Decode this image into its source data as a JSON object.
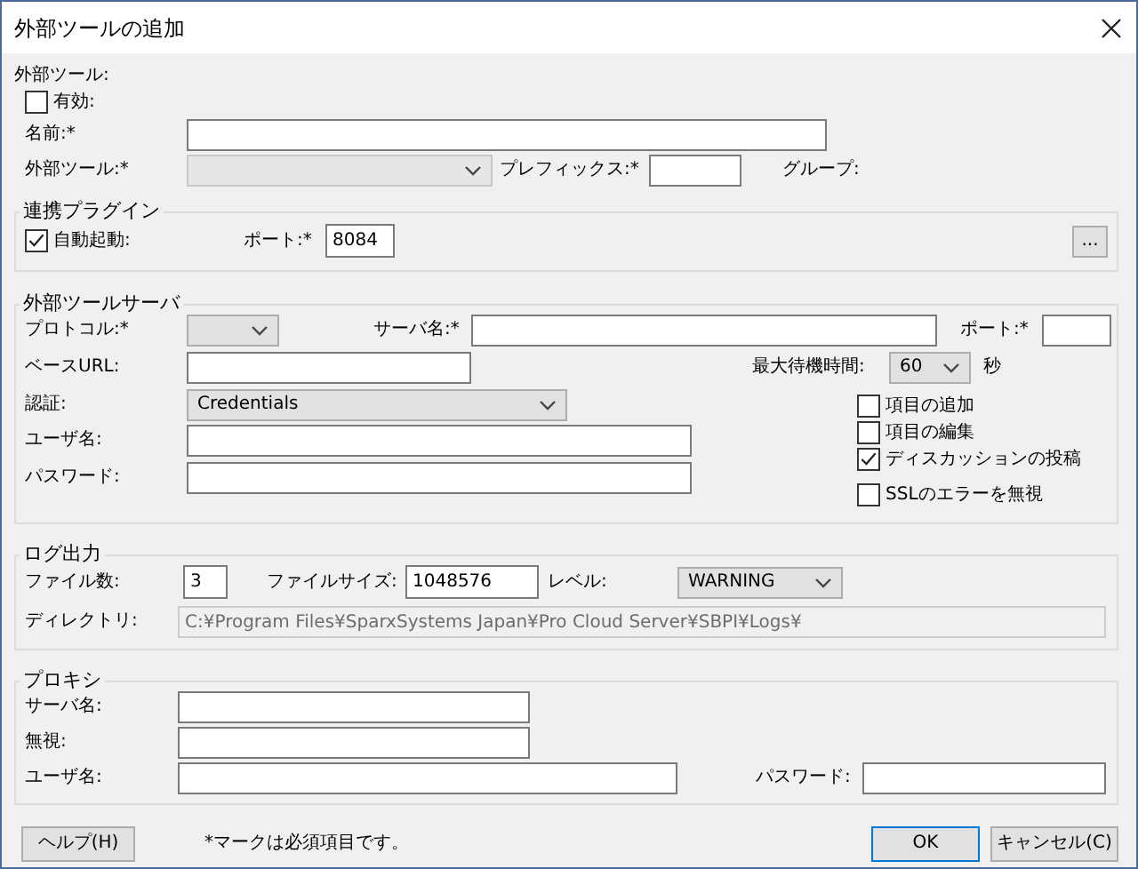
{
  "window": {
    "title": "外部ツールの追加"
  },
  "external_tool": {
    "heading": "外部ツール:",
    "enabled": {
      "label": "有効:",
      "checked": false
    },
    "name_label": "名前:*",
    "tool_label": "外部ツール:*",
    "tool_select": {
      "disabled": true
    },
    "prefix_label": "プレフィックス:*",
    "group_label": "グループ:"
  },
  "plugin": {
    "legend": "連携プラグイン",
    "auto_start": {
      "label": "自動起動:",
      "checked": true
    },
    "port_label": "ポート:*",
    "port_value": "8084",
    "more_button": "..."
  },
  "server": {
    "legend": "外部ツールサーバ",
    "protocol_label": "プロトコル:*",
    "server_name_label": "サーバ名:*",
    "port_label": "ポート:*",
    "base_url_label": "ベースURL:",
    "timeout_label": "最大待機時間:",
    "timeout_value": "60",
    "timeout_unit": "秒",
    "auth_label": "認証:",
    "auth_value": "Credentials",
    "username_label": "ユーザ名:",
    "password_label": "パスワード:",
    "options": [
      {
        "label": "項目の追加",
        "checked": false
      },
      {
        "label": "項目の編集",
        "checked": false
      },
      {
        "label": "ディスカッションの投稿",
        "checked": true
      },
      {
        "label": "SSLのエラーを無視",
        "checked": false
      }
    ]
  },
  "logging": {
    "legend": "ログ出力",
    "file_count_label": "ファイル数:",
    "file_count": "3",
    "file_size_label": "ファイルサイズ:",
    "file_size": "1048576",
    "level_label": "レベル:",
    "level_value": "WARNING",
    "directory_label": "ディレクトリ:",
    "directory": {
      "value": "C:¥Program Files¥SparxSystems Japan¥Pro Cloud Server¥SBPI¥Logs¥",
      "disabled": true
    }
  },
  "proxy": {
    "legend": "プロキシ",
    "server_label": "サーバ名:",
    "ignore_label": "無視:",
    "username_label": "ユーザ名:",
    "password_label": "パスワード:"
  },
  "footer": {
    "help_button": "ヘルプ(H)",
    "note": "*マークは必須項目です。",
    "ok_button": "OK",
    "cancel_button": "キャンセル(C)"
  }
}
